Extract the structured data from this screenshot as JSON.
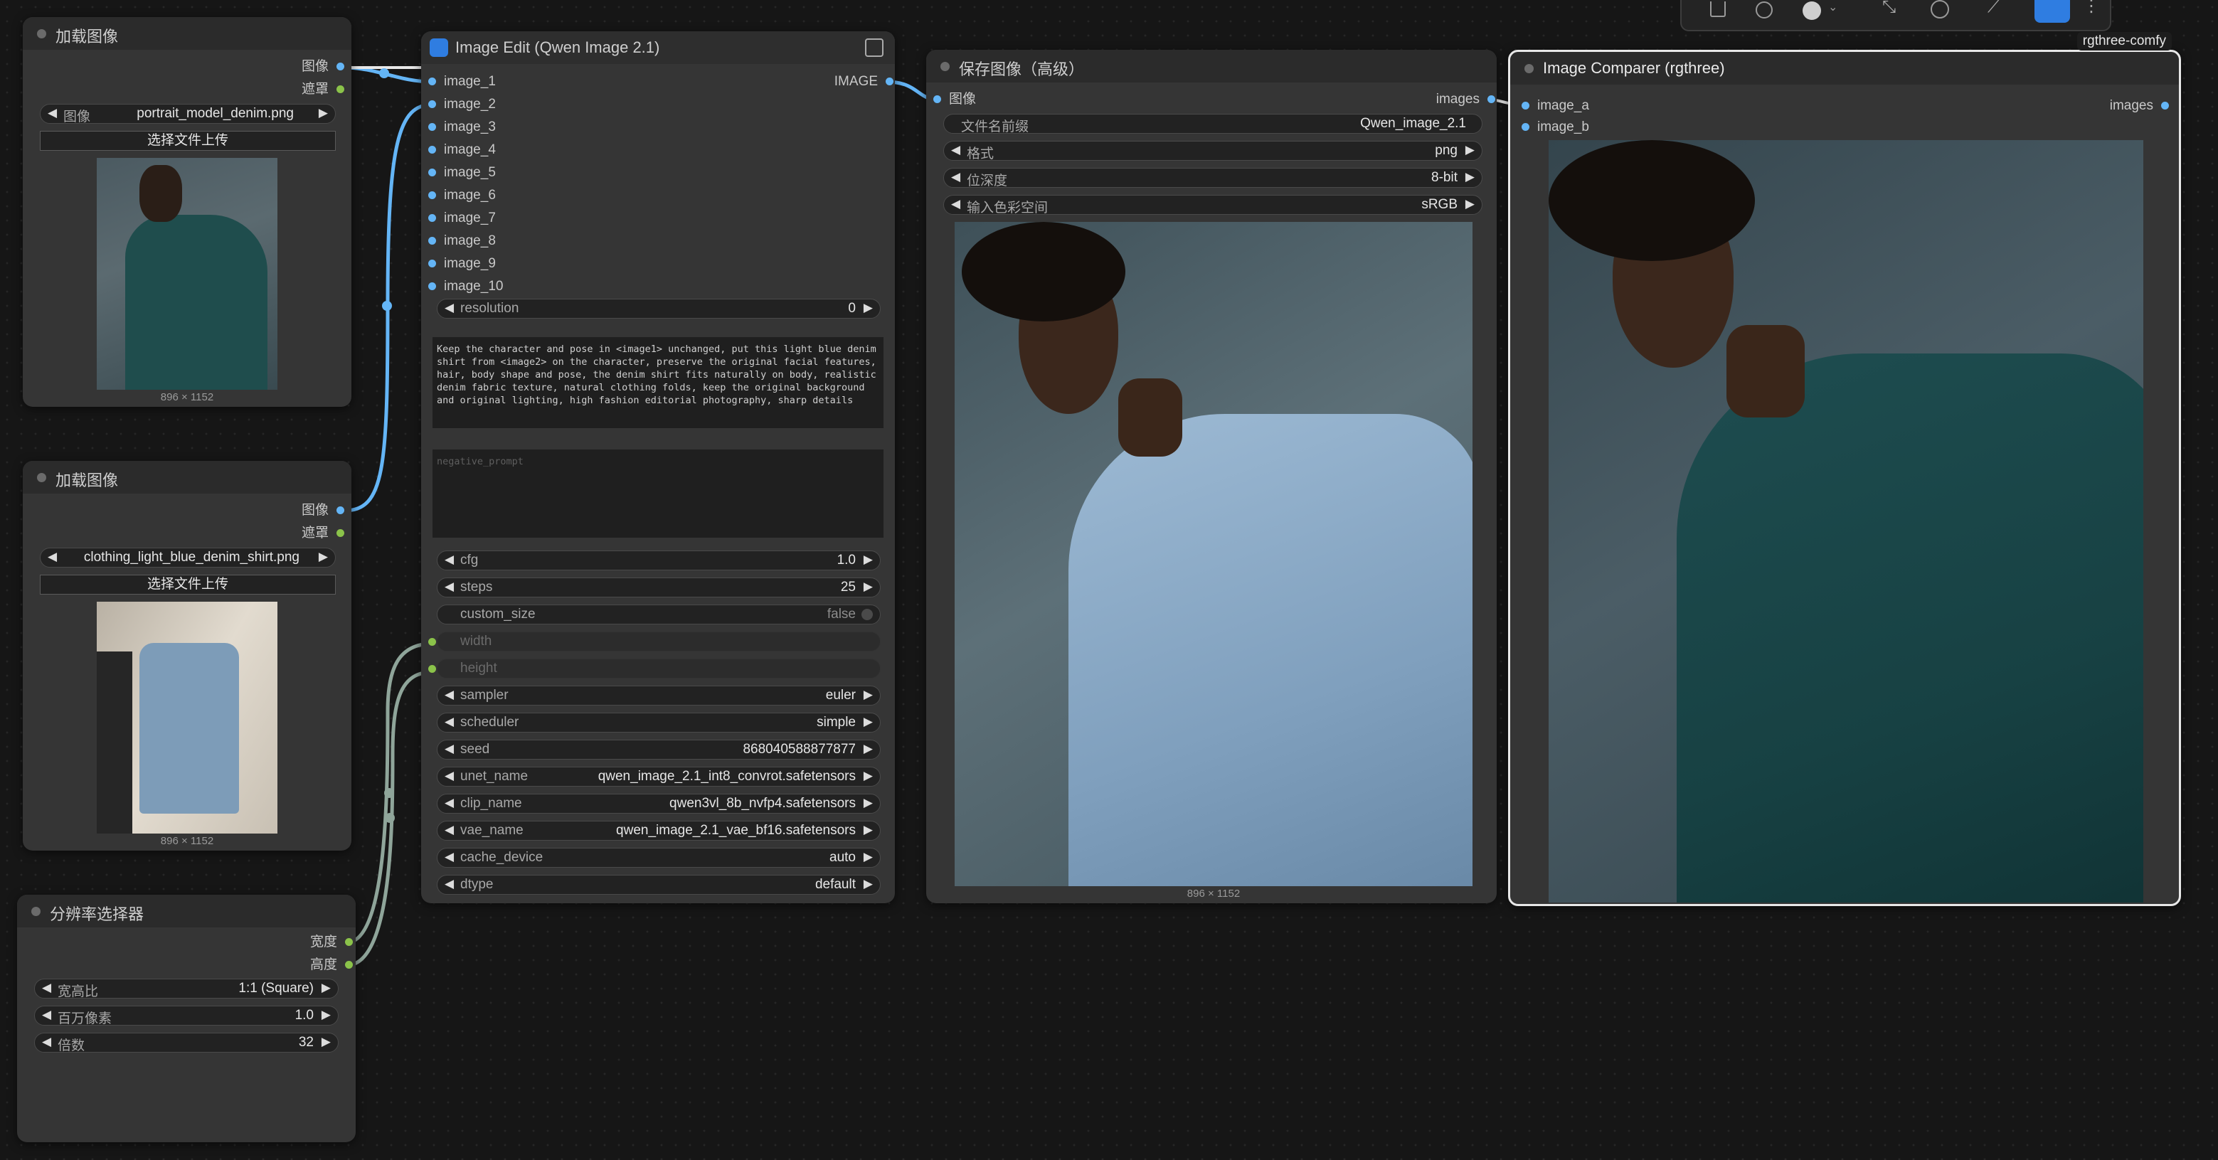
{
  "canvas_nodes": {
    "load_image_1": {
      "title": "加载图像",
      "outputs": [
        "图像",
        "遮罩"
      ],
      "image_widget_label": "图像",
      "image_file": "portrait_model_denim.png",
      "upload_label": "选择文件上传",
      "dims": "896 × 1152"
    },
    "load_image_2": {
      "title": "加载图像",
      "outputs": [
        "图像",
        "遮罩"
      ],
      "image_widget_label": "图像",
      "image_file": "clothing_light_blue_denim_shirt.png",
      "upload_label": "选择文件上传",
      "dims": "896 × 1152"
    },
    "resolution_selector": {
      "title": "分辨率选择器",
      "outputs": [
        "宽度",
        "高度"
      ],
      "widgets": [
        {
          "label": "宽高比",
          "value": "1:1 (Square)"
        },
        {
          "label": "百万像素",
          "value": "1.0"
        },
        {
          "label": "倍数",
          "value": "32"
        }
      ]
    },
    "image_edit": {
      "title": "Image Edit (Qwen Image 2.1)",
      "inputs": [
        "image_1",
        "image_2",
        "image_3",
        "image_4",
        "image_5",
        "image_6",
        "image_7",
        "image_8",
        "image_9",
        "image_10"
      ],
      "output": "IMAGE",
      "resolution": {
        "label": "resolution",
        "value": "0"
      },
      "prompt": "Keep the character and pose in <image1> unchanged, put this light blue denim shirt from <image2> on the character, preserve the original facial features, hair, body shape and pose, the denim shirt fits naturally on body, realistic denim fabric texture, natural clothing folds, keep the original background and original lighting, high fashion editorial photography, sharp details",
      "negative_placeholder": "negative_prompt",
      "widgets": [
        {
          "label": "cfg",
          "value": "1.0"
        },
        {
          "label": "steps",
          "value": "25"
        }
      ],
      "custom_size": {
        "label": "custom_size",
        "value": "false"
      },
      "inputs_disabled": [
        {
          "label": "width"
        },
        {
          "label": "height"
        }
      ],
      "widgets2": [
        {
          "label": "sampler",
          "value": "euler"
        },
        {
          "label": "scheduler",
          "value": "simple"
        },
        {
          "label": "seed",
          "value": "868040588877877"
        },
        {
          "label": "unet_name",
          "value": "qwen_image_2.1_int8_convrot.safetensors"
        },
        {
          "label": "clip_name",
          "value": "qwen3vl_8b_nvfp4.safetensors"
        },
        {
          "label": "vae_name",
          "value": "qwen_image_2.1_vae_bf16.safetensors"
        },
        {
          "label": "cache_device",
          "value": "auto"
        },
        {
          "label": "dtype",
          "value": "default"
        }
      ]
    },
    "save_image": {
      "title": "保存图像（高级）",
      "input": "图像",
      "output": "images",
      "widgets": [
        {
          "label": "文件名前缀",
          "value": "Qwen_image_2.1"
        },
        {
          "label": "格式",
          "value": "png"
        },
        {
          "label": "位深度",
          "value": "8-bit"
        },
        {
          "label": "输入色彩空间",
          "value": "sRGB"
        }
      ],
      "dims": "896 × 1152"
    },
    "image_comparer": {
      "title": "Image Comparer (rgthree)",
      "badge": "rgthree-comfy",
      "inputs": [
        "image_a",
        "image_b"
      ],
      "output": "images"
    }
  },
  "colors": {
    "image_link": "#64b5f6",
    "int_link": "#8bc34a",
    "accent": "#2f7de1"
  },
  "toolbar_icons": [
    "trash-icon",
    "info-icon",
    "color-icon",
    "fit-icon",
    "history-icon",
    "chart-icon",
    "run-icon",
    "more-icon"
  ]
}
